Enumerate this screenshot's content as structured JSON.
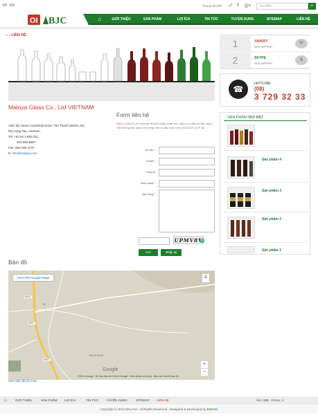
{
  "topbar": {
    "lang_vn": "VN",
    "lang_en": "EN",
    "follow": "Chúng tôi trên",
    "social": [
      "f",
      "g+"
    ],
    "search_placeholder": "Tìm kiếm..."
  },
  "brand": {
    "logo_text": "BJC",
    "primary": "#1e7d2c",
    "accent": "#c0392b"
  },
  "nav": {
    "items": [
      "GIỚI THIỆU",
      "SẢN PHẨM",
      "LỢI ÍCH",
      "TIN TỨC",
      "TUYỂN DỤNG",
      "SITEMAP",
      "LIÊN HỆ"
    ]
  },
  "breadcrumb": "LIÊN HỆ",
  "company": {
    "name": "Malaya Glass Co., Ltd VIETNAM",
    "addr1": "Add: My Xuan A Industrial Zone, Tan Thanh District, Ba",
    "addr2": "Ria Vung Tau, Vietnam",
    "tel": "Tel:  +84 64 3 893 311",
    "tel2": "403 569 8897",
    "fax": "Fax: 064-392 4747",
    "email_label": "E:",
    "email": "info@malaya.com"
  },
  "form": {
    "title": "Form liên hệ",
    "note_req": "Chú ý:",
    "note": "Dấu (*) các trường bắt buộc phải nhập vào. Quý vị có thể gõ chữ tiếng Việt không dấu hoặc chữ tiếng Việt có dấu theo font UNICODE (UTF-8).",
    "labels": [
      "Họ tên *",
      "Email *",
      "Công ty",
      "Điện thoại *",
      "Nội dung *"
    ],
    "captcha": "UPMV8V",
    "submit": "Gửi",
    "reset": "Nhập lại"
  },
  "map": {
    "title": "Bản đồ",
    "view_large": "Xem bản đồ lớn hơn",
    "open_google": "Xem trên Google Maps",
    "footer": "©2014 Google · Dữ liệu bản đồ ©2014 Google · Điều khoản sử dụng · Báo cáo một lỗi bản đồ",
    "google": "Google",
    "place": "TÂN PHƯỚC",
    "road1": "AH17",
    "road2": "AH17",
    "road3": "51",
    "road4": "AH17"
  },
  "support": [
    {
      "num": "1",
      "name": "YAHOO!",
      "sub": "NICK SUPPORT",
      "color": "#c0392b"
    },
    {
      "num": "2",
      "name": "SKYPE",
      "sub": "NICK SUPPORT",
      "color": "#1e7d2c"
    }
  ],
  "hotline": {
    "label": "HOTLINE",
    "prefix": "(08)",
    "number": "3 729 32 33"
  },
  "featured": {
    "title_a": "SẢN PHẨM",
    "title_b": " NỔI BẬT",
    "items": [
      "",
      "Sản phẩm 4",
      "Sản phẩm 3",
      "Sản phẩm 2",
      "Sản phẩm 1"
    ]
  },
  "footer": {
    "items": [
      "GIỚI THIỆU",
      "SẢN PHẨM",
      "LỢI ÍCH",
      "TIN TỨC",
      "TUYỂN DỤNG",
      "SITEMAP",
      "LIÊN HỆ"
    ],
    "hits_label": "Hits:",
    "hits": "840",
    "online_label": "Online:",
    "online": "1",
    "copy_a": "Copyright © 2013 MALAYA . All Rights Reserved - Designed & Developed by",
    "copy_b": "EMSVN"
  }
}
